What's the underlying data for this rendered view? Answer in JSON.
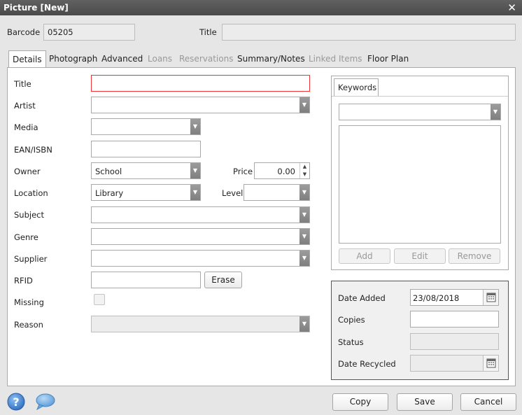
{
  "window": {
    "title": "Picture [New]",
    "close_glyph": "✕"
  },
  "header": {
    "barcode_label": "Barcode",
    "barcode_value": "05205",
    "title_label": "Title",
    "title_value": ""
  },
  "tabs": [
    {
      "label": "Details",
      "active": true,
      "enabled": true
    },
    {
      "label": "Photograph",
      "enabled": true
    },
    {
      "label": "Advanced",
      "enabled": true
    },
    {
      "label": "Loans",
      "enabled": false
    },
    {
      "label": "Reservations",
      "enabled": false
    },
    {
      "label": "Summary/Notes",
      "enabled": true
    },
    {
      "label": "Linked Items",
      "enabled": false
    },
    {
      "label": "Floor Plan",
      "enabled": true
    }
  ],
  "details": {
    "title": {
      "label": "Title",
      "value": ""
    },
    "artist": {
      "label": "Artist",
      "value": ""
    },
    "media": {
      "label": "Media",
      "value": ""
    },
    "ean": {
      "label": "EAN/ISBN",
      "value": ""
    },
    "owner": {
      "label": "Owner",
      "value": "School"
    },
    "price": {
      "label": "Price",
      "value": "0.00"
    },
    "location": {
      "label": "Location",
      "value": "Library"
    },
    "level": {
      "label": "Level",
      "value": ""
    },
    "subject": {
      "label": "Subject",
      "value": ""
    },
    "genre": {
      "label": "Genre",
      "value": ""
    },
    "supplier": {
      "label": "Supplier",
      "value": ""
    },
    "rfid": {
      "label": "RFID",
      "value": "",
      "erase_label": "Erase"
    },
    "missing": {
      "label": "Missing",
      "checked": false
    },
    "reason": {
      "label": "Reason",
      "value": ""
    }
  },
  "keywords": {
    "tab_label": "Keywords",
    "selected": "",
    "items": [],
    "add_label": "Add",
    "edit_label": "Edit",
    "remove_label": "Remove"
  },
  "dates": {
    "date_added_label": "Date Added",
    "date_added_value": "23/08/2018",
    "copies_label": "Copies",
    "copies_value": "",
    "status_label": "Status",
    "status_value": "",
    "date_recycled_label": "Date Recycled",
    "date_recycled_value": ""
  },
  "footer": {
    "copy_label": "Copy",
    "save_label": "Save",
    "cancel_label": "Cancel"
  },
  "icons": {
    "help": "help-icon",
    "chat": "chat-icon",
    "dropdown": "chevron-down-icon",
    "calendar": "calendar-icon"
  },
  "colors": {
    "title_bar": "#4f4f4f",
    "error_border": "#e33333",
    "help_icon": "#3a78c8"
  }
}
